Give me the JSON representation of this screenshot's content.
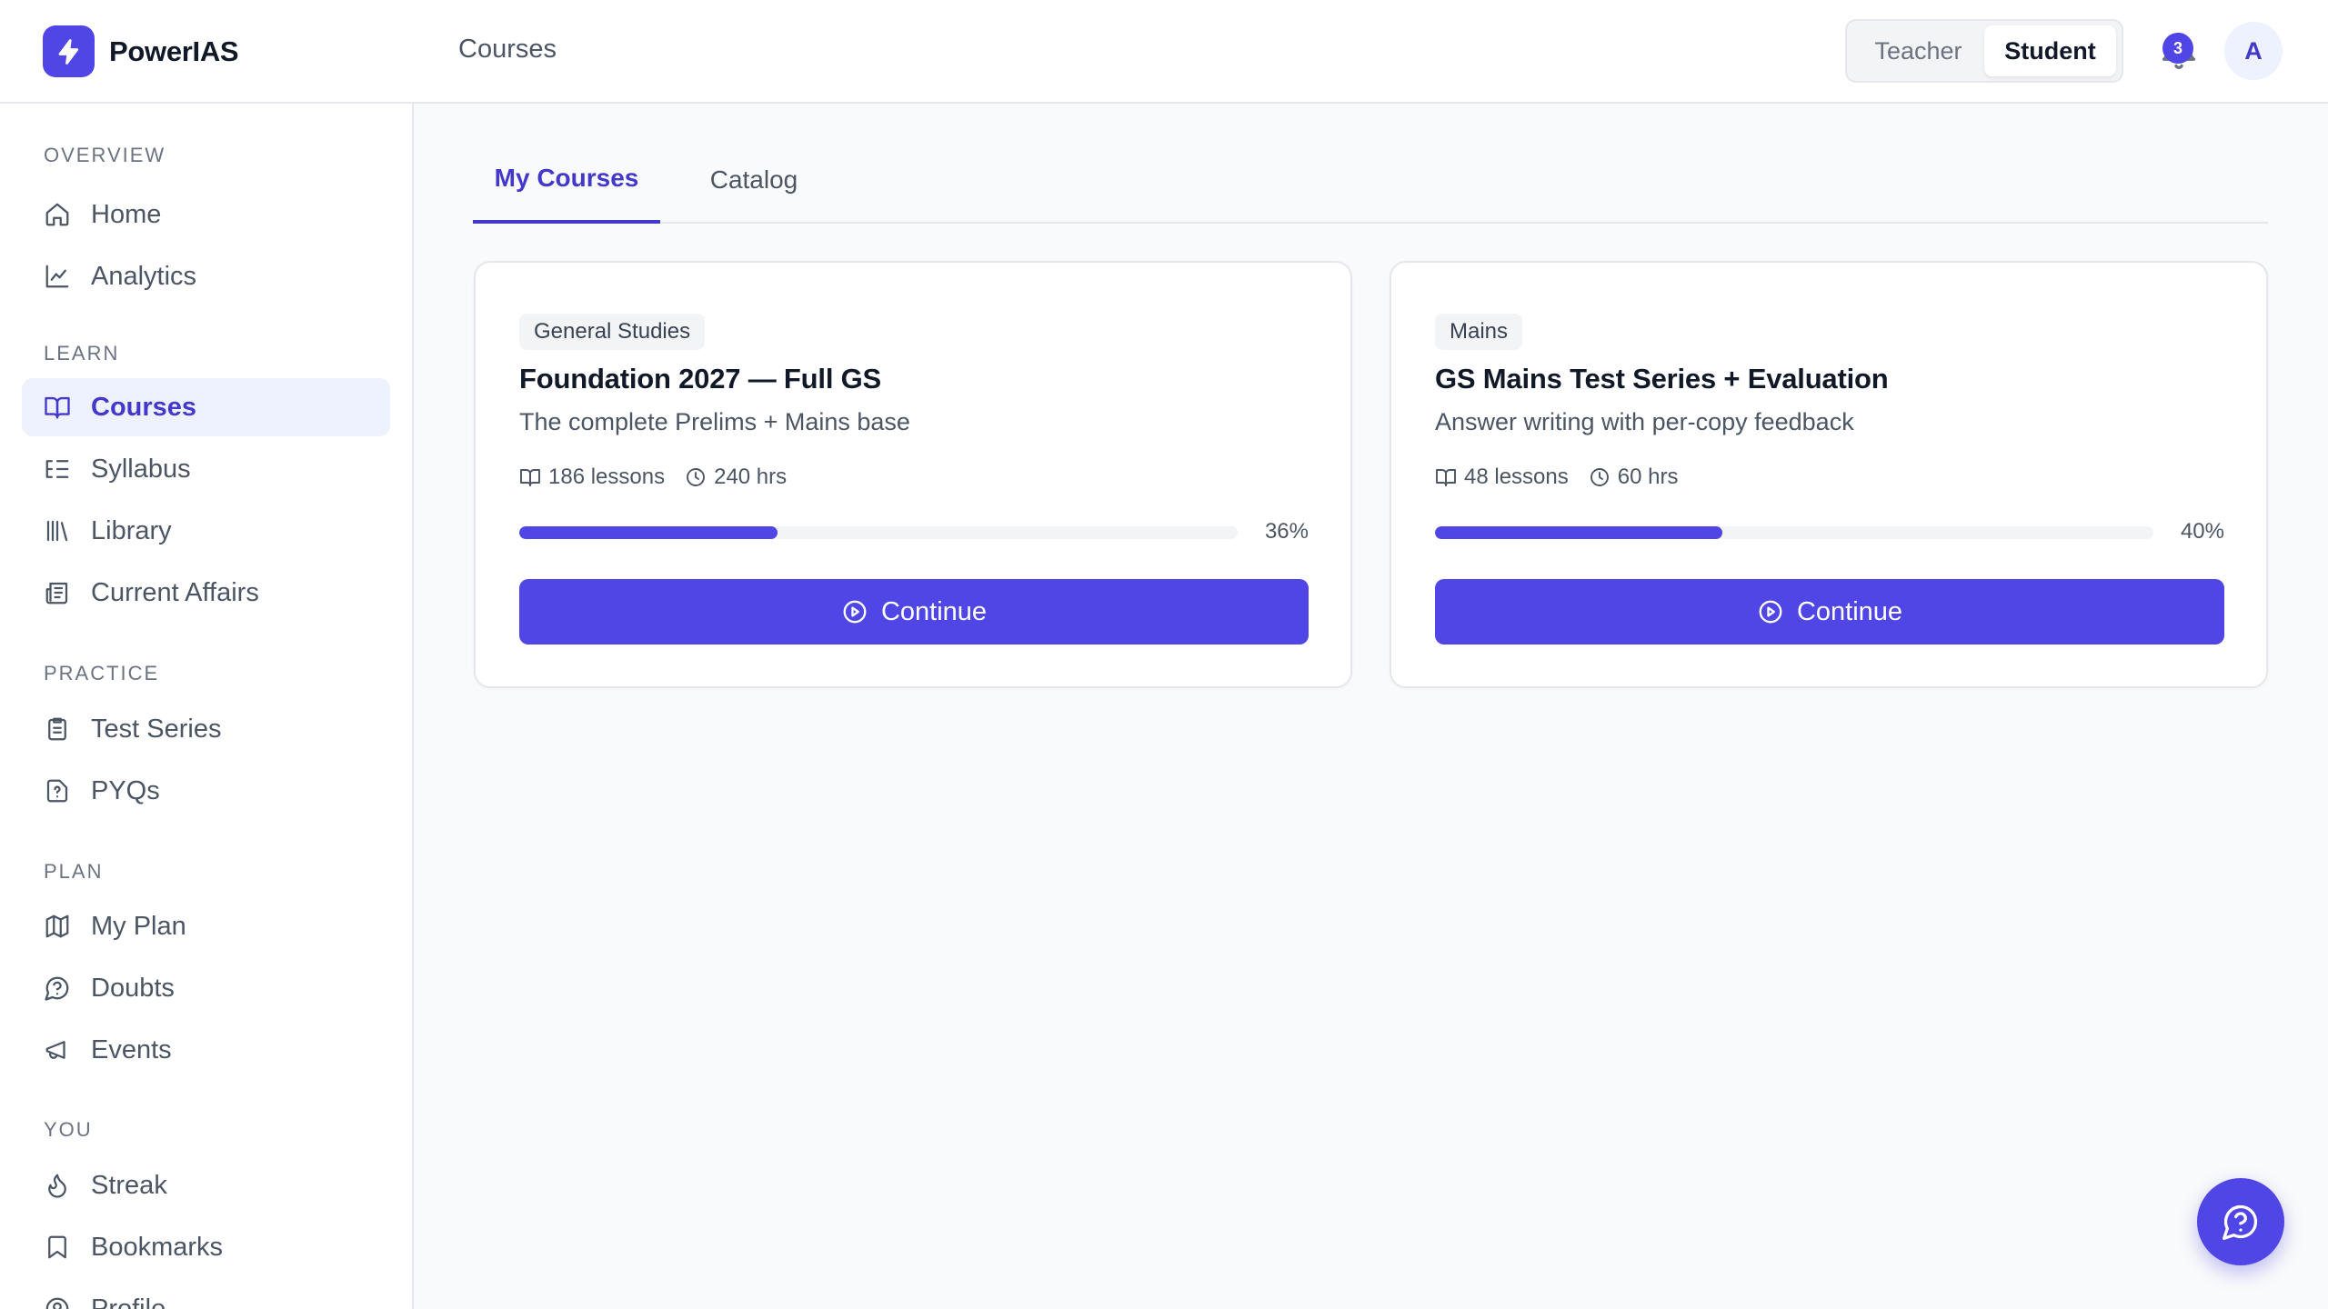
{
  "app": {
    "name": "PowerIAS",
    "logo_icon": "lightning-bolt-icon"
  },
  "header": {
    "breadcrumb": "Courses",
    "roles": {
      "teacher": "Teacher",
      "student": "Student",
      "selected": "Student"
    },
    "notifications": {
      "count": "3",
      "icon": "bell-icon"
    },
    "avatar_initial": "A"
  },
  "sidebar": {
    "sections": [
      {
        "label": "OVERVIEW",
        "items": [
          {
            "label": "Home",
            "icon": "home-icon"
          },
          {
            "label": "Analytics",
            "icon": "line-chart-icon"
          }
        ]
      },
      {
        "label": "LEARN",
        "items": [
          {
            "label": "Courses",
            "icon": "open-book-icon",
            "active": true
          },
          {
            "label": "Syllabus",
            "icon": "list-tree-icon"
          },
          {
            "label": "Library",
            "icon": "library-icon"
          },
          {
            "label": "Current Affairs",
            "icon": "newspaper-icon"
          }
        ]
      },
      {
        "label": "PRACTICE",
        "items": [
          {
            "label": "Test Series",
            "icon": "clipboard-icon"
          },
          {
            "label": "PYQs",
            "icon": "file-question-icon"
          }
        ]
      },
      {
        "label": "PLAN",
        "items": [
          {
            "label": "My Plan",
            "icon": "map-icon"
          },
          {
            "label": "Doubts",
            "icon": "question-bubble-icon"
          },
          {
            "label": "Events",
            "icon": "megaphone-icon"
          }
        ]
      },
      {
        "label": "YOU",
        "items": [
          {
            "label": "Streak",
            "icon": "flame-icon"
          },
          {
            "label": "Bookmarks",
            "icon": "bookmark-icon"
          },
          {
            "label": "Profile",
            "icon": "user-circle-icon"
          }
        ]
      }
    ]
  },
  "tabs": [
    {
      "label": "My Courses",
      "active": true
    },
    {
      "label": "Catalog",
      "active": false
    }
  ],
  "courses": [
    {
      "tag": "General Studies",
      "title": "Foundation 2027 — Full GS",
      "subtitle": "The complete Prelims + Mains base",
      "lessons": "186 lessons",
      "hours": "240 hrs",
      "progress": 36,
      "progress_label": "36%",
      "cta": "Continue"
    },
    {
      "tag": "Mains",
      "title": "GS Mains Test Series + Evaluation",
      "subtitle": "Answer writing with per-copy feedback",
      "lessons": "48 lessons",
      "hours": "60 hrs",
      "progress": 40,
      "progress_label": "40%",
      "cta": "Continue"
    }
  ],
  "colors": {
    "accent": "#4f46e5",
    "accent_soft": "#eef2ff",
    "accent_text": "#4338ca"
  }
}
